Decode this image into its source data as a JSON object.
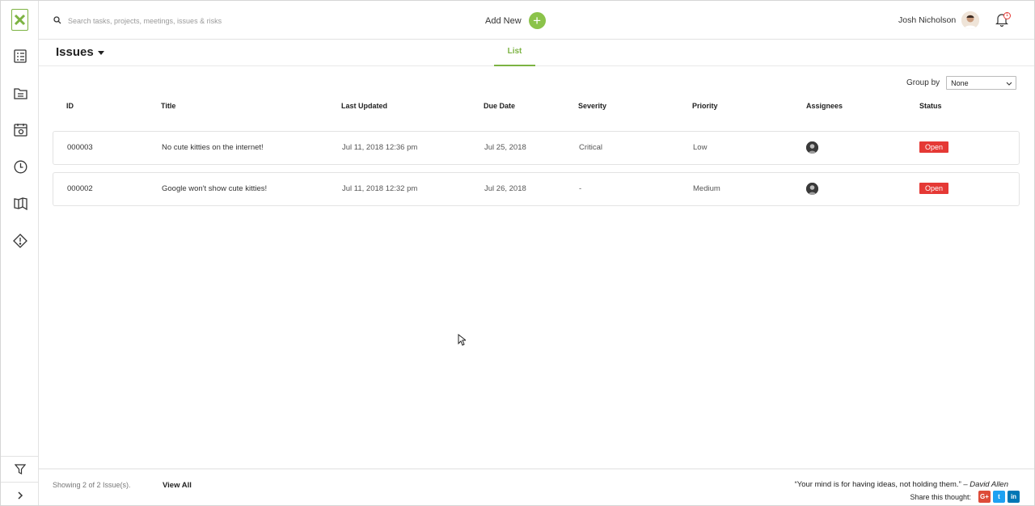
{
  "search": {
    "placeholder": "Search tasks, projects, meetings, issues & risks"
  },
  "topbar": {
    "add_new_label": "Add New",
    "add_new_symbol": "+",
    "user_name": "Josh Nicholson",
    "notification_count": "1"
  },
  "page": {
    "title": "Issues",
    "tabs": [
      {
        "label": "List",
        "active": true
      }
    ]
  },
  "group_by": {
    "label": "Group by",
    "selected": "None"
  },
  "table": {
    "columns": [
      "ID",
      "Title",
      "Last Updated",
      "Due Date",
      "Severity",
      "Priority",
      "Assignees",
      "Status"
    ],
    "rows": [
      {
        "id": "000003",
        "title": "No cute kitties on the internet!",
        "last_updated": "Jul 11, 2018 12:36 pm",
        "due_date": "Jul 25, 2018",
        "severity": "Critical",
        "priority": "Low",
        "status": "Open"
      },
      {
        "id": "000002",
        "title": "Google won't show cute kitties!",
        "last_updated": "Jul 11, 2018 12:32 pm",
        "due_date": "Jul 26, 2018",
        "severity": "-",
        "priority": "Medium",
        "status": "Open"
      }
    ]
  },
  "footer": {
    "showing": "Showing 2 of 2 Issue(s).",
    "view_all": "View All",
    "quote": "“Your mind is for having ideas, not holding them.” –",
    "quote_author": "David Allen",
    "share_label": "Share this thought:",
    "social": [
      {
        "name": "google-plus",
        "text": "G+",
        "color": "#dd4b39"
      },
      {
        "name": "twitter",
        "text": "t",
        "color": "#1da1f2"
      },
      {
        "name": "linkedin",
        "text": "in",
        "color": "#0077b5"
      }
    ]
  },
  "colors": {
    "accent": "#8bc34a",
    "status_open": "#e53935"
  },
  "icons": [
    "logo-icon",
    "checklist-icon",
    "folder-icon",
    "calendar-icon",
    "clock-icon",
    "map-icon",
    "warning-icon",
    "filter-icon",
    "chevron-right-icon",
    "search-icon",
    "bell-icon"
  ]
}
